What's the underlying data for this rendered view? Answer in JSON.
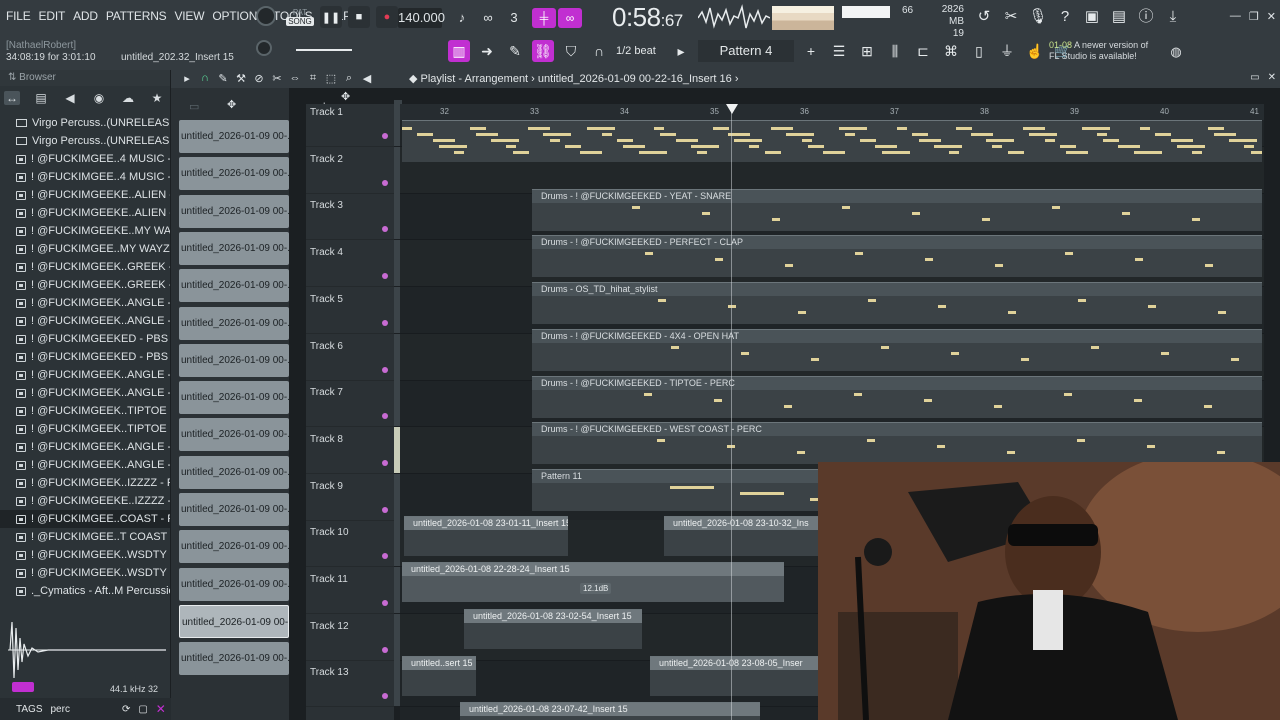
{
  "menu": [
    "FILE",
    "EDIT",
    "ADD",
    "PATTERNS",
    "VIEW",
    "OPTIONS",
    "TOOLS",
    "HELP"
  ],
  "hint": {
    "user": "[NathaelRobert]",
    "time": "34:08:19 for 3:01:10",
    "file": "untitled_202.32_Insert 15"
  },
  "transport": {
    "pat_label": "PAT",
    "song_label": "SONG",
    "tempo": "140.000",
    "time_main": "0:58",
    "time_sub": ":67"
  },
  "meters": {
    "volume": "66",
    "memory": "2826 MB",
    "cpu": "19"
  },
  "snap": "1/2 beat",
  "pattern": "Pattern 4",
  "news": {
    "date": "01-08",
    "line1": "A newer version of",
    "line2": "FL Studio is available!"
  },
  "browser": {
    "title": "Browser",
    "items": [
      {
        "label": "Virgo Percuss..(UNRELEASED)",
        "kind": "folder"
      },
      {
        "label": "Virgo Percuss..(UNRELEASED)",
        "kind": "folder"
      },
      {
        "label": "! @FUCKIMGEE..4 MUSIC - PERC",
        "kind": "file"
      },
      {
        "label": "! @FUCKIMGEE..4 MUSIC - PERC",
        "kind": "file"
      },
      {
        "label": "! @FUCKIMGEEKE..ALIEN - PERC",
        "kind": "file"
      },
      {
        "label": "! @FUCKIMGEEKE..ALIEN - PERC",
        "kind": "file"
      },
      {
        "label": "! @FUCKIMGEEKE..MY WAYZ - PERC",
        "kind": "file"
      },
      {
        "label": "! @FUCKIMGEE..MY WAYZ - PERC",
        "kind": "file"
      },
      {
        "label": "! @FUCKIMGEEK..GREEK - PERC",
        "kind": "file"
      },
      {
        "label": "! @FUCKIMGEEK..GREEK - PERC",
        "kind": "file"
      },
      {
        "label": "! @FUCKIMGEEK..ANGLE - PERC",
        "kind": "file"
      },
      {
        "label": "! @FUCKIMGEEK..ANGLE - PERC",
        "kind": "file"
      },
      {
        "label": "! @FUCKIMGEEKED - PBS - PERC",
        "kind": "file"
      },
      {
        "label": "! @FUCKIMGEEKED - PBS - PERC",
        "kind": "file"
      },
      {
        "label": "! @FUCKIMGEEK..ANGLE - PERC",
        "kind": "file"
      },
      {
        "label": "! @FUCKIMGEEK..ANGLE - PERC",
        "kind": "file"
      },
      {
        "label": "! @FUCKIMGEEK..TIPTOE - PERC",
        "kind": "file"
      },
      {
        "label": "! @FUCKIMGEEK..TIPTOE - PERC",
        "kind": "file"
      },
      {
        "label": "! @FUCKIMGEEK..ANGLE - PERC",
        "kind": "file"
      },
      {
        "label": "! @FUCKIMGEEK..ANGLE - PERC",
        "kind": "file"
      },
      {
        "label": "! @FUCKIMGEEK..IZZZZ - PERC",
        "kind": "file"
      },
      {
        "label": "! @FUCKIMGEEKE..IZZZZ - PERC",
        "kind": "file"
      },
      {
        "label": "! @FUCKIMGEE..COAST - PERC",
        "kind": "file"
      },
      {
        "label": "! @FUCKIMGEE..T COAST - PERC",
        "kind": "file"
      },
      {
        "label": "! @FUCKIMGEEK..WSDTY - PERC",
        "kind": "file"
      },
      {
        "label": "! @FUCKIMGEEK..WSDTY - PERC",
        "kind": "file"
      },
      {
        "label": "._Cymatics - Aft..M Percussion 1",
        "kind": "file"
      }
    ],
    "selected_index": 22,
    "preview_rate": "44.1 kHz",
    "preview_bits": "32",
    "tags_label": "TAGS",
    "tags_value": "perc"
  },
  "playlist": {
    "title": "Playlist - Arrangement",
    "project": "untitled_2026-01-09 00-22-16_Insert 16",
    "ruler": [
      "32",
      "33",
      "34",
      "35",
      "36",
      "37",
      "38",
      "39",
      "40",
      "41"
    ],
    "clip_picker": [
      "untitled_2026-01-09 00-...",
      "untitled_2026-01-09 00-...",
      "untitled_2026-01-09 00-...",
      "untitled_2026-01-09 00-...",
      "untitled_2026-01-09 00-...",
      "untitled_2026-01-09 00-...",
      "untitled_2026-01-09 00-...",
      "untitled_2026-01-09 00-...",
      "untitled_2026-01-09 00-...",
      "untitled_2026-01-09 00-...",
      "untitled_2026-01-09 00-...",
      "untitled_2026-01-09 00-...",
      "untitled_2026-01-09 00-...",
      "untitled_2026-01-09 00-...",
      "untitled_2026-01-09 00-..."
    ],
    "clip_picker_selected": 13,
    "tracks": [
      "Track 1",
      "Track 2",
      "Track 3",
      "Track 4",
      "Track 5",
      "Track 6",
      "Track 7",
      "Track 8",
      "Track 9",
      "Track 10",
      "Track 11",
      "Track 12",
      "Track 13"
    ],
    "pattern_clips": [
      "Drums - ! @FUCKIMGEEKED - YEAT - SNARE",
      "Drums - ! @FUCKIMGEEKED - PERFECT - CLAP",
      "Drums - OS_TD_hihat_stylist",
      "Drums - ! @FUCKIMGEEKED - 4X4 - OPEN HAT",
      "Drums - ! @FUCKIMGEEKED - TIPTOE - PERC",
      "Drums - ! @FUCKIMGEEKED - WEST COAST - PERC",
      "Pattern 11"
    ],
    "audio_clips": {
      "t9a": "untitled_2026-01-08 23-01-11_Insert 15",
      "t9b": "untitled_2026-01-08 23-10-32_Ins",
      "t10": "untitled_2026-01-08 22-28-24_Insert 15",
      "t10_gain": "12.1dB",
      "t11": "untitled_2026-01-08 23-02-54_Insert 15",
      "t12a": "untitled..sert 15",
      "t12b": "untitled_2026-01-08 23-08-05_Inser",
      "t13": "untitled_2026-01-08 23-07-42_Insert 15"
    }
  },
  "colors": {
    "accent": "#c12fd1",
    "notes": "#e0d29a",
    "bg": "#1f2427"
  }
}
